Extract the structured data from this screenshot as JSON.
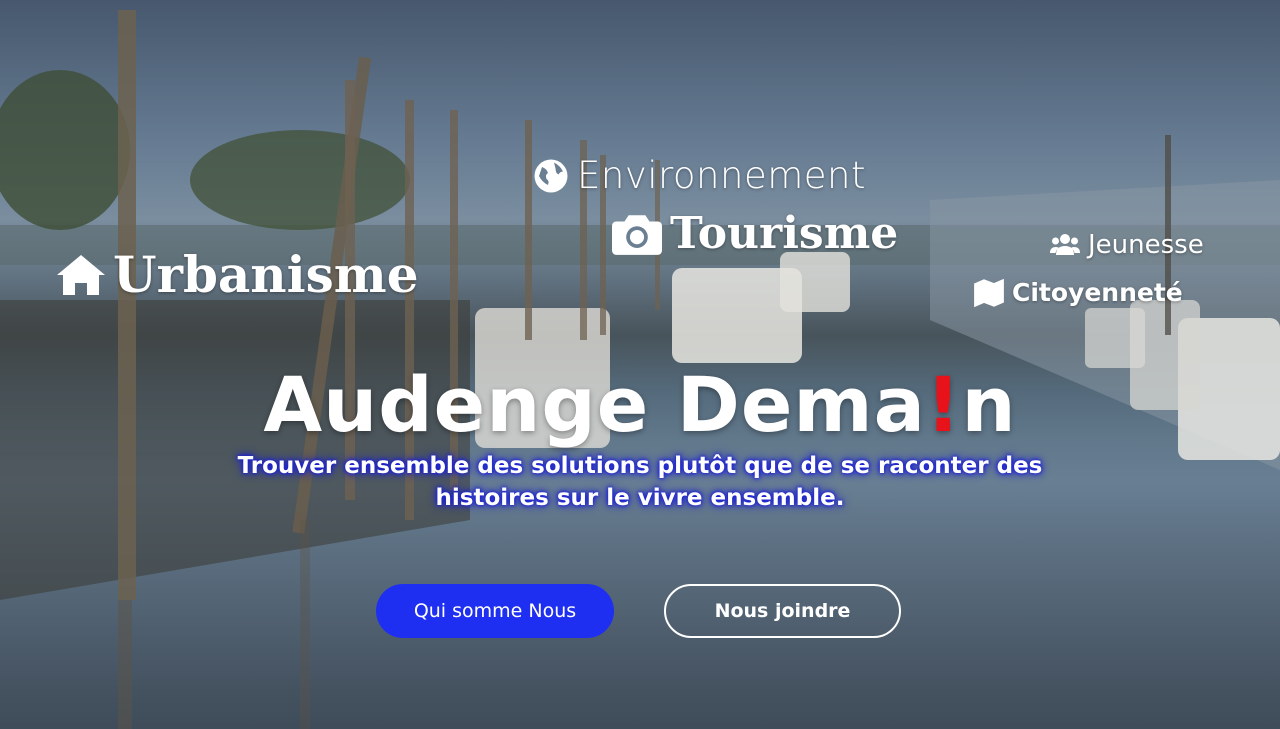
{
  "topics": {
    "environnement": "Environnement",
    "tourisme": "Tourisme",
    "urbanisme": "Urbanisme",
    "jeunesse": "Jeunesse",
    "citoyennete": "Citoyenneté"
  },
  "hero": {
    "title_part1": "Audenge Dema",
    "title_excl": "!",
    "title_part2": "n",
    "tagline": "Trouver ensemble des solutions plutôt que de se raconter des histoires sur le vivre ensemble."
  },
  "buttons": {
    "primary": "Qui somme Nous",
    "secondary": "Nous joindre"
  },
  "colors": {
    "accent_blue": "#1f2ff2",
    "title_accent_red": "#e8121b",
    "text": "#ffffff"
  },
  "icons": {
    "environnement": "globe-icon",
    "tourisme": "camera-icon",
    "urbanisme": "home-icon",
    "jeunesse": "users-icon",
    "citoyennete": "map-icon"
  }
}
